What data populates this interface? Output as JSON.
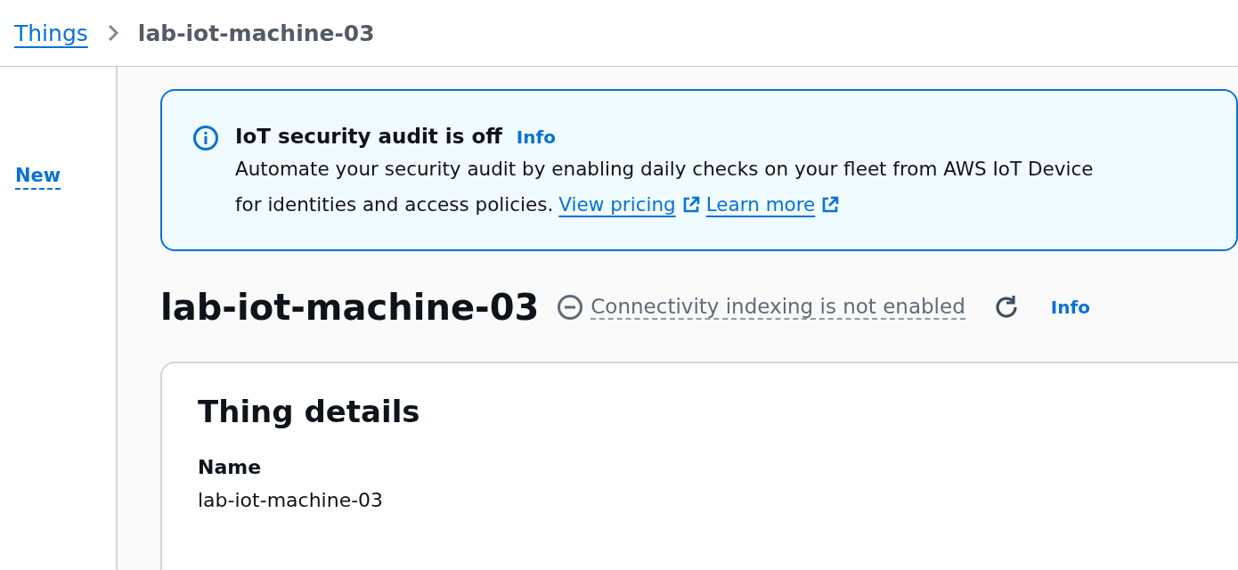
{
  "breadcrumb": {
    "items": [
      {
        "label": "Things",
        "kind": "link"
      },
      {
        "label": "lab-iot-machine-03",
        "kind": "current"
      }
    ]
  },
  "sidebar": {
    "badge": "New"
  },
  "alert": {
    "title": "IoT security audit is off",
    "info": "Info",
    "line_1": "Automate your security audit by enabling daily checks on your fleet from AWS IoT Device",
    "line_2": "for identities and access policies.",
    "links": [
      {
        "label": "View pricing"
      },
      {
        "label": "Learn more"
      }
    ]
  },
  "header": {
    "title": "lab-iot-machine-03",
    "status": "Connectivity indexing is not enabled",
    "info": "Info"
  },
  "details": {
    "title": "Thing details",
    "fields": [
      {
        "label": "Name",
        "value": "lab-iot-machine-03"
      }
    ]
  }
}
